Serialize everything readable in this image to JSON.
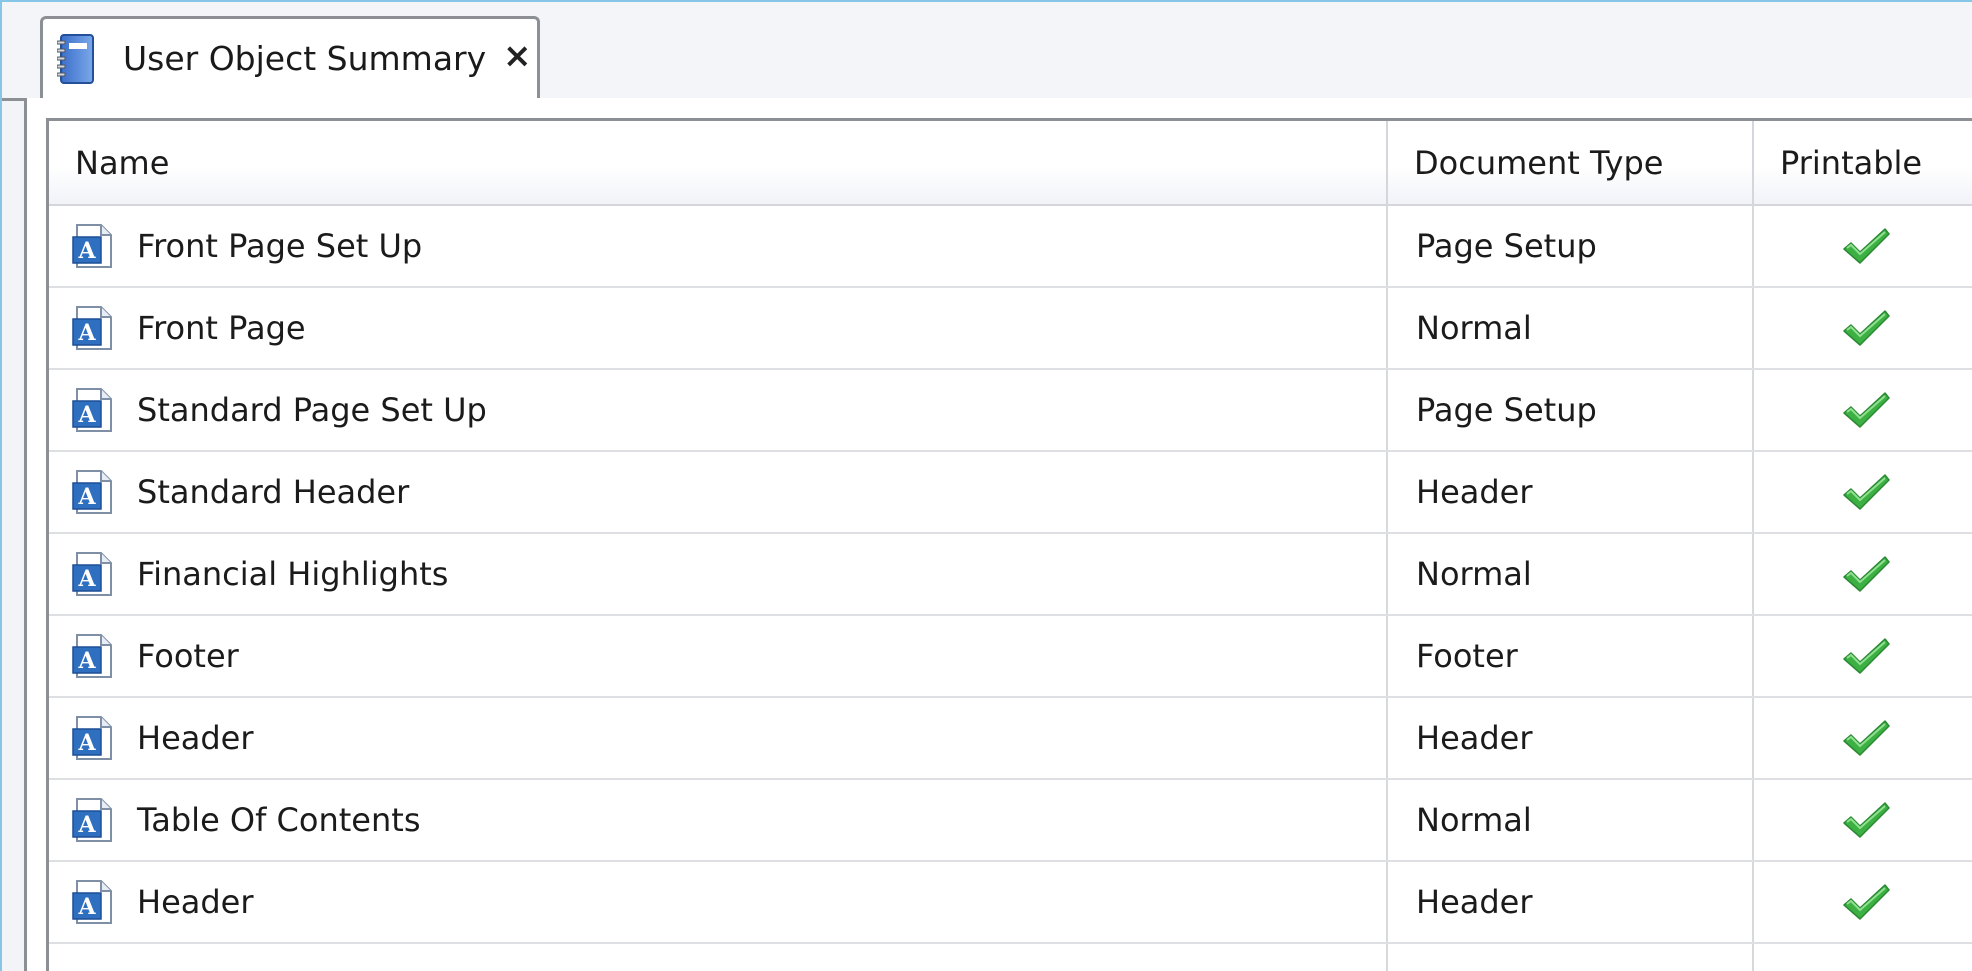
{
  "tab": {
    "title": "User Object Summary",
    "close_label": "×",
    "icon": "notebook-icon"
  },
  "table": {
    "columns": [
      "Name",
      "Document Type",
      "Printable"
    ],
    "row_icon": "text-document-icon",
    "printable_icon": "green-checkmark-icon",
    "rows": [
      {
        "name": "Front Page Set Up",
        "type": "Page Setup",
        "printable": true
      },
      {
        "name": "Front Page",
        "type": "Normal",
        "printable": true
      },
      {
        "name": "Standard Page Set Up",
        "type": "Page Setup",
        "printable": true
      },
      {
        "name": "Standard Header",
        "type": "Header",
        "printable": true
      },
      {
        "name": "Financial Highlights",
        "type": "Normal",
        "printable": true
      },
      {
        "name": "Footer",
        "type": "Footer",
        "printable": true
      },
      {
        "name": "Header",
        "type": "Header",
        "printable": true
      },
      {
        "name": "Table Of Contents",
        "type": "Normal",
        "printable": true
      },
      {
        "name": "Header",
        "type": "Header",
        "printable": true
      }
    ]
  },
  "colors": {
    "accent_border": "#86c6e6",
    "check_green": "#3cb043",
    "icon_blue": "#2f6fc0"
  }
}
